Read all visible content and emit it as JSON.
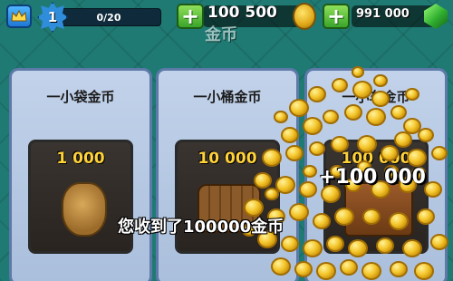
{
  "topbar": {
    "crown_icon": "crown-icon",
    "level": "1",
    "xp": {
      "text": "0/20",
      "progress": 0.0
    },
    "gold_plus_label": "+",
    "gold_amount": "100 500",
    "gold_icon": "gold-coin-icon",
    "gem_plus_label": "+",
    "gem_amount": "991 000",
    "gem_icon": "gem-icon"
  },
  "section_header": "金币",
  "offers": [
    {
      "title": "一小袋金币",
      "amount": "1 000",
      "icon": "gold-bag-icon"
    },
    {
      "title": "一小桶金币",
      "amount": "10 000",
      "icon": "gold-barrel-icon"
    },
    {
      "title": "一小车金币",
      "amount": "100 000",
      "icon": "gold-cart-icon"
    }
  ],
  "reward": {
    "amount": "+100 000"
  },
  "message": "您收到了100000金币"
}
